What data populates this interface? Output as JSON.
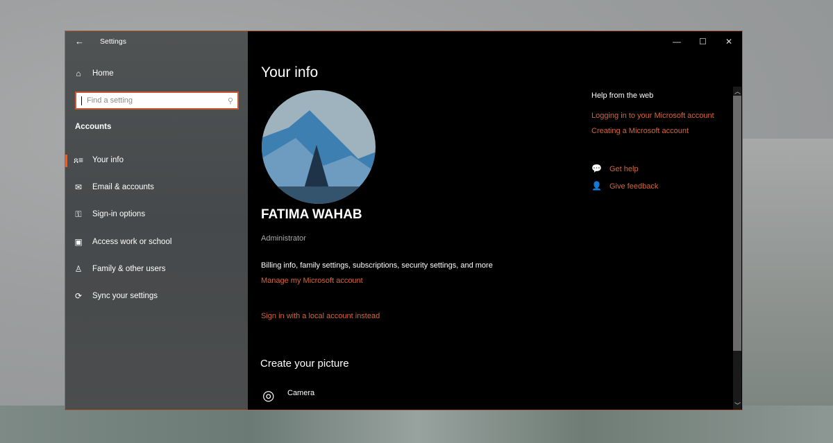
{
  "window": {
    "title": "Settings",
    "minimize": "—",
    "maximize": "☐",
    "close": "✕",
    "back": "←"
  },
  "sidebar": {
    "home": "Home",
    "search_placeholder": "Find a setting",
    "section": "Accounts",
    "items": [
      {
        "label": "Your info",
        "icon": "person-list-icon",
        "active": true
      },
      {
        "label": "Email & accounts",
        "icon": "mail-icon"
      },
      {
        "label": "Sign-in options",
        "icon": "key-icon"
      },
      {
        "label": "Access work or school",
        "icon": "briefcase-icon"
      },
      {
        "label": "Family & other users",
        "icon": "person-add-icon"
      },
      {
        "label": "Sync your settings",
        "icon": "sync-icon"
      }
    ]
  },
  "main": {
    "title": "Your info",
    "name": "FATIMA WAHAB",
    "role": "Administrator",
    "billing": "Billing info, family settings, subscriptions, security settings, and more",
    "manage_link": "Manage my Microsoft account",
    "local_link": "Sign in with a local account instead",
    "create_title": "Create your picture",
    "camera": "Camera"
  },
  "help": {
    "title": "Help from the web",
    "links": [
      "Logging in to your Microsoft account",
      "Creating a Microsoft account"
    ],
    "get_help": "Get help",
    "feedback": "Give feedback"
  },
  "colors": {
    "accent": "#d4663a",
    "sidebar": "#4a4d4f",
    "content": "#000000"
  }
}
